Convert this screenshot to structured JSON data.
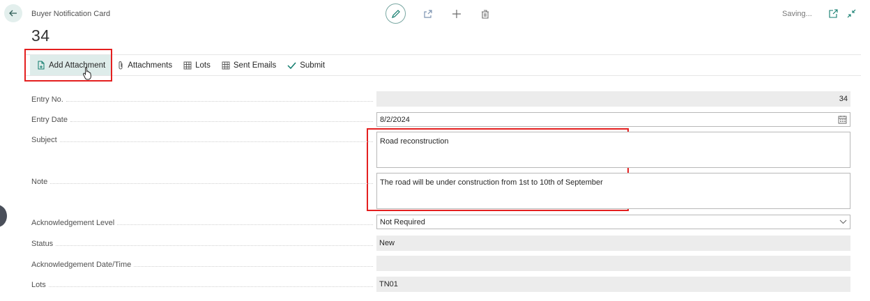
{
  "header": {
    "caption": "Buyer Notification Card",
    "record_no": "34",
    "status_text": "Saving..."
  },
  "toolbar": {
    "add_attachment": "Add Attachment",
    "attachments": "Attachments",
    "lots": "Lots",
    "sent_emails": "Sent Emails",
    "submit": "Submit"
  },
  "fields": {
    "entry_no": {
      "label": "Entry No.",
      "value": "34"
    },
    "entry_date": {
      "label": "Entry Date",
      "value": "8/2/2024"
    },
    "subject": {
      "label": "Subject",
      "value": "Road reconstruction"
    },
    "note": {
      "label": "Note",
      "value": "The road will be under construction from 1st to 10th of September"
    },
    "ack_level": {
      "label": "Acknowledgement Level",
      "value": "Not Required"
    },
    "status": {
      "label": "Status",
      "value": "New"
    },
    "ack_datetime": {
      "label": "Acknowledgement Date/Time",
      "value": ""
    },
    "lots": {
      "label": "Lots",
      "value": "TN01"
    }
  },
  "icons": [
    "back-arrow-icon",
    "pencil-icon",
    "share-icon",
    "plus-icon",
    "trash-icon",
    "open-new-window-icon",
    "collapse-icon",
    "document-add-icon",
    "paperclip-icon",
    "grid-icon",
    "checkmark-icon",
    "calendar-icon",
    "chevron-down-icon"
  ],
  "colors": {
    "accent": "#0f7b6c",
    "highlight": "#e41f1f",
    "active_bg": "#deecea"
  }
}
